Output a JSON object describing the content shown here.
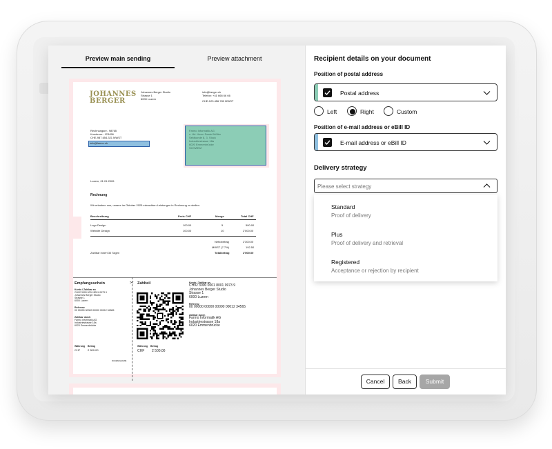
{
  "tabs": {
    "main": "Preview main sending",
    "attachment": "Preview attachment"
  },
  "invoice": {
    "logo_line1": "JOHANNES",
    "logo_line2": "BERGER",
    "sender_name": "Johannes Berger Studio",
    "sender_street": "Strasse 1",
    "sender_city": "6000 Luzern",
    "email": "info@berger.ch",
    "phone": "Telefon: +41 666 66 66",
    "vat": "CHE-123.456.789 MWST",
    "customer_ref": "Rechnungsnr.: 98765",
    "customer_no": "Kundennr.: 123456",
    "customer_vat": "CHE-987.654.321 MWST",
    "customer_email": "info@farmo.ch",
    "recipient_line1": "Farmo Informatik AG",
    "recipient_line2": "z. Hd. Herrn Daniel Müller",
    "recipient_line3": "Sektkunde 8, 3. Stock",
    "recipient_line4": "Industriestrasse 18a",
    "recipient_line5": "6020 Emmenbrücke",
    "recipient_line6": "SCHWEIZ",
    "date": "Luzern, 01.01.2026",
    "title": "Rechnung",
    "intro": "Wir erlauben uns, unsere im Oktober 2025 erbrachten Leistungen in Rechnung zu stellen.",
    "col_desc": "Beschreibung",
    "col_price": "Preis CHF",
    "col_qty": "Menge",
    "col_total": "Total CHF",
    "rows": [
      {
        "desc": "Logo Design",
        "price": "100.00",
        "qty": "5",
        "total": "500.00"
      },
      {
        "desc": "Website Design",
        "price": "100.00",
        "qty": "10",
        "total": "2'000.00"
      }
    ],
    "net_label": "Nettobetrag",
    "net_value": "2'300.00",
    "vat_label": "MWST (7.7%)",
    "vat_value": "192.50",
    "total_label": "Totalbetrag",
    "total_value": "2'500.00",
    "payment_terms": "Zahlbar innert 30 Tagen",
    "receipt_title": "Empfangsschein",
    "receipt_account_label": "Konto / Zahlbar an",
    "receipt_iban": "CH92 3000 0001 8001 0973 9",
    "receipt_name": "Johannes Berger Studio",
    "receipt_street": "Strasse 1",
    "receipt_city": "6000 Luzern",
    "receipt_ref_label": "Referenz",
    "receipt_ref": "00 00000 00000 00000 00012 34565",
    "receipt_payer_label": "Zahlbar durch",
    "receipt_payer1": "Farmo Informatik AG",
    "receipt_payer2": "Industriestrasse 18a",
    "receipt_payer3": "6020 Emmenbrücke",
    "receipt_cur_label": "Währung",
    "receipt_amt_label": "Betrag",
    "receipt_cur": "CHF",
    "receipt_amt": "2 500.00",
    "receipt_accept": "Annahmestelle",
    "pay_title": "Zahlteil",
    "pay_cur": "CHF",
    "pay_amt": "2 500.00",
    "pay_account_label": "Konto / Zahlbar an",
    "pay_iban": "CH92 3000 0001 8001 0973 9",
    "pay_name": "Johannes Berger Studio",
    "pay_street": "Strasse 1",
    "pay_city": "6000 Luzern",
    "pay_ref_label": "Referenz",
    "pay_ref": "00 00000 00000 00000 00012 34565",
    "pay_payer_label": "Zahlbar durch",
    "pay_payer1": "Farmo Informatik AG",
    "pay_payer2": "Industriestrasse 18a",
    "pay_payer3": "6020 Emmenbrücke"
  },
  "panel": {
    "title": "Recipient details on your document",
    "postal_label": "Position of postal address",
    "postal_select": "Postal address",
    "radio_left": "Left",
    "radio_right": "Right",
    "radio_custom": "Custom",
    "radio_selected": "Right",
    "email_label": "Position of e-mail address or eBill ID",
    "email_select": "E-mail address or eBill ID",
    "delivery_title": "Delivery strategy",
    "strategy_placeholder": "Please select strategy",
    "options": [
      {
        "name": "Standard",
        "desc": "Proof of delivery"
      },
      {
        "name": "Plus",
        "desc": "Proof of delivery and retrieval"
      },
      {
        "name": "Registered",
        "desc": "Acceptance or rejection by recipient"
      }
    ],
    "cancel": "Cancel",
    "back": "Back",
    "submit": "Submit"
  },
  "colors": {
    "accent_green": "#8ccdb6",
    "email_highlight": "#8fc0e0",
    "address_zone": "#fde8ea",
    "submit_disabled": "#a6a6a6"
  },
  "icons": [
    "checkbox-checked-icon",
    "chevron-down-icon",
    "chevron-up-icon",
    "scissors-icon",
    "qr-code"
  ]
}
